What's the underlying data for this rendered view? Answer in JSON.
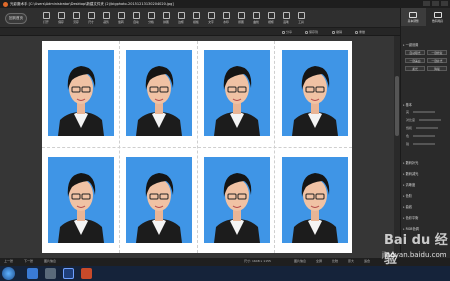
{
  "window": {
    "title": "光影魔术手  [C:\\Users\\Administrator\\Desktop\\新建文件夹 (2)\\bigphoto-20151213130204020.jpg]"
  },
  "toolbar": {
    "back_label": "回到首页",
    "tools": [
      "打开",
      "保存",
      "另存",
      "尺寸",
      "裁剪",
      "旋转",
      "自动",
      "分格",
      "拼图",
      "边框",
      "模板",
      "文字",
      "水印",
      "抠图",
      "曲线",
      "相框",
      "画笔",
      "工具"
    ]
  },
  "subbar": {
    "items": [
      "分享",
      "保存到",
      "撤销",
      "重做"
    ]
  },
  "right_panel": {
    "tabs": [
      {
        "label": "基本调整",
        "active": true
      },
      {
        "label": "数码暗房",
        "active": false
      }
    ],
    "sections": [
      "一键设置",
      "基本",
      "数码补光",
      "数码减光",
      "清晰度",
      "色阶",
      "曲线",
      "色彩平衡",
      "RGB色调"
    ],
    "quick_buttons": [
      "自动曝光",
      "一键修复",
      "一键美白",
      "一键补光",
      "柔光",
      "降噪"
    ],
    "basic_rows": [
      "亮",
      "对比度",
      "饱和",
      "色",
      "锐"
    ]
  },
  "statusbar": {
    "left_items": [
      "上一张",
      "下一张",
      "图片信息"
    ],
    "right_items": [
      "尺寸: 1648 x 1155",
      "图片信息",
      "全屏",
      "比较",
      "原大",
      "适合"
    ]
  },
  "canvas": {
    "grid": {
      "cols": 4,
      "rows": 2
    }
  },
  "colors": {
    "photo_background": "#3f95e6",
    "paper": "#ffffff",
    "canvas": "#363636"
  },
  "watermark": {
    "brand": "Bai du 经验",
    "url": "jingyan.baidu.com"
  }
}
